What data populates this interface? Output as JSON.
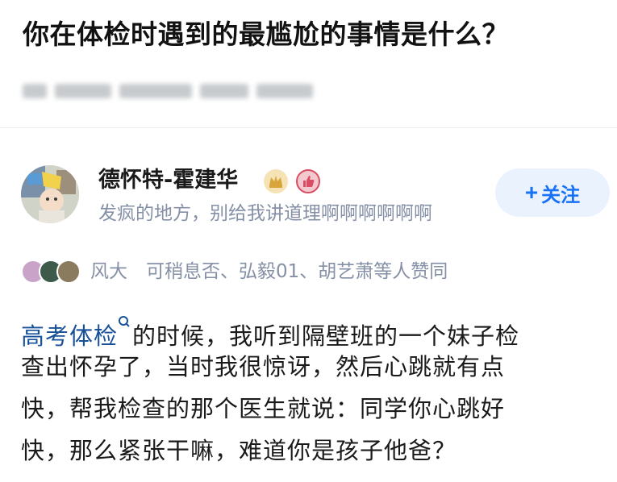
{
  "question": {
    "title": "你在体检时遇到的最尴尬的事情是什么？"
  },
  "author": {
    "name": "德怀特-霍建华",
    "signature": "发疯的地方，别给我讲道理啊啊啊啊啊啊",
    "follow_label": "关注",
    "follow_plus": "+"
  },
  "voters": {
    "text": "风大　可稍息否、弘毅01、胡艺萧等人赞同"
  },
  "answer": {
    "link_text": "高考体检",
    "line1_rest": "的时候，我听到隔壁班的一个妹子检",
    "line2": "查出怀孕了，当时我很惊讶，然后心跳就有点",
    "line3": "快，帮我检查的那个医生就说：同学你心跳好",
    "line4": "快，那么紧张干嘛，难道你是孩子他爸？"
  },
  "colors": {
    "link": "#175199",
    "follow_text": "#1772f6",
    "follow_bg": "#eaf2fd",
    "meta_gray": "#8590a6"
  }
}
